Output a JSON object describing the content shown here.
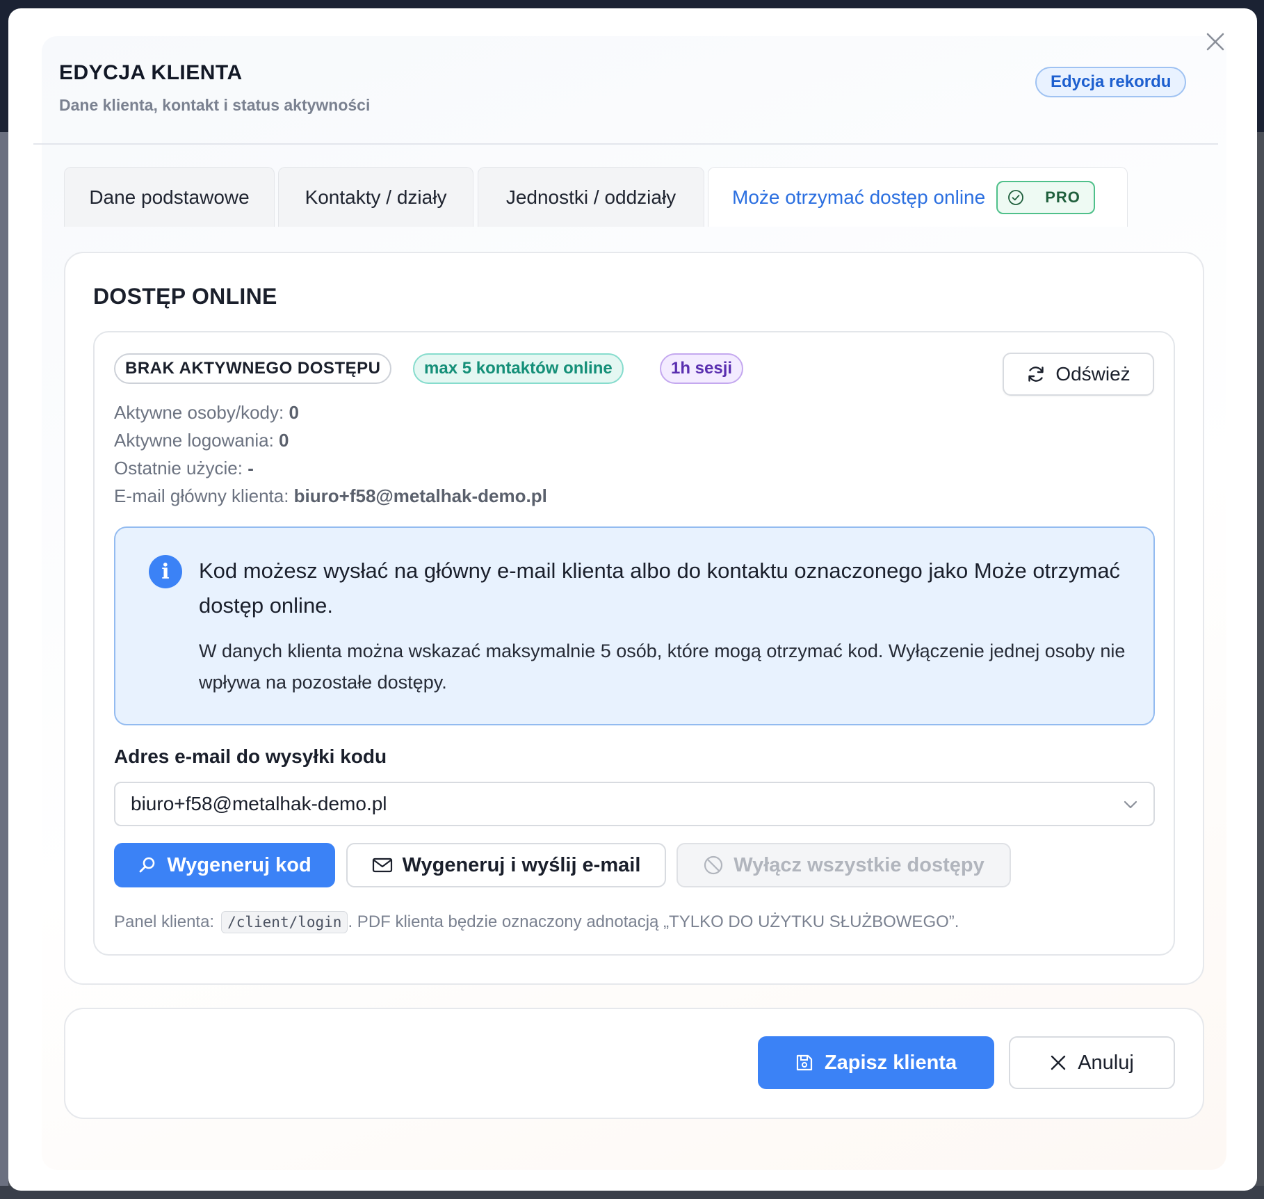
{
  "header": {
    "title": "EDYCJA KLIENTA",
    "subtitle": "Dane klienta, kontakt i status aktywności",
    "mode_badge": "Edycja rekordu"
  },
  "tabs": [
    {
      "label": "Dane podstawowe",
      "active": false
    },
    {
      "label": "Kontakty / działy",
      "active": false
    },
    {
      "label": "Jednostki / oddziały",
      "active": false
    },
    {
      "label": "Może otrzymać dostęp online",
      "active": true,
      "badge": "PRO",
      "badge_icon": "check-circle-icon"
    }
  ],
  "section": {
    "title": "DOSTĘP ONLINE",
    "status_pill": "BRAK AKTYWNEGO DOSTĘPU",
    "contacts_pill": "max 5 kontaktów online",
    "session_pill": "1h sesji",
    "refresh_label": "Odśwież",
    "stats": [
      {
        "label": "Aktywne osoby/kody:",
        "value": "0"
      },
      {
        "label": "Aktywne logowania:",
        "value": "0"
      },
      {
        "label": "Ostatnie użycie:",
        "value": "-"
      },
      {
        "label": "E-mail główny klienta:",
        "value": "biuro+f58@metalhak-demo.pl"
      }
    ],
    "info": {
      "icon": "info-icon",
      "main": "Kod możesz wysłać na główny e-mail klienta albo do kontaktu oznaczonego jako Może otrzymać dostęp online.",
      "sub": "W danych klienta można wskazać maksymalnie 5 osób, które mogą otrzymać kod. Wyłączenie jednej osoby nie wpływa na pozostałe dostępy."
    },
    "email_field": {
      "label": "Adres e-mail do wysyłki kodu",
      "value": "biuro+f58@metalhak-demo.pl"
    },
    "actions": {
      "generate": "Wygeneruj kod",
      "generate_send": "Wygeneruj i wyślij e-mail",
      "disable_all": "Wyłącz wszystkie dostępy"
    },
    "footnote": {
      "prefix": "Panel klienta:",
      "path": "/client/login",
      "suffix": ". PDF klienta będzie oznaczony adnotacją „TYLKO DO UŻYTKU SŁUŻBOWEGO”."
    }
  },
  "footer": {
    "save_label": "Zapisz klienta",
    "cancel_label": "Anuluj"
  },
  "colors": {
    "accent": "#3b82f6",
    "accent_text": "#2b6fe0",
    "pro_green": "#4fc08a",
    "info_bg": "#e8f2fe"
  }
}
